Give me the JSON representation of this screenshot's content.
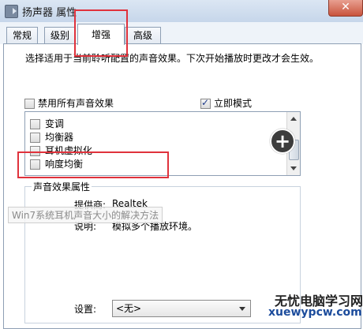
{
  "window": {
    "title": "扬声器 属性",
    "close_glyph": "✕",
    "close_label": "关闭"
  },
  "tabs": [
    {
      "label": "常规",
      "active": false
    },
    {
      "label": "级别",
      "active": false
    },
    {
      "label": "增强",
      "active": true
    },
    {
      "label": "高级",
      "active": false
    }
  ],
  "description": "选择适用于当前聆听配置的声音效果。下次开始播放时更改才会生效。",
  "options": {
    "disable_all": {
      "label": "禁用所有声音效果",
      "checked": false
    },
    "immediate_mode": {
      "label": "立即模式",
      "checked": true
    }
  },
  "effects": [
    {
      "label": "变调",
      "checked": false
    },
    {
      "label": "均衡器",
      "checked": false
    },
    {
      "label": "耳机虚拟化",
      "checked": false
    },
    {
      "label": "响度均衡",
      "checked": false
    }
  ],
  "properties": {
    "legend": "声音效果属性",
    "provider_label": "提供商:",
    "provider_value": "Realtek",
    "description_label": "说明:",
    "description_value": "模拟多个播放环境。",
    "settings_label": "设置:",
    "settings_value": "<无>"
  },
  "overlays": {
    "plus_glyph": "+",
    "watermark": "Win7系统耳机声音大小的解决方法",
    "site_name": "无忧电脑学习网",
    "site_url": "xuewypcw.com"
  },
  "colors": {
    "highlight_box": "#e0323c",
    "tab_border": "#8e9fb4"
  }
}
